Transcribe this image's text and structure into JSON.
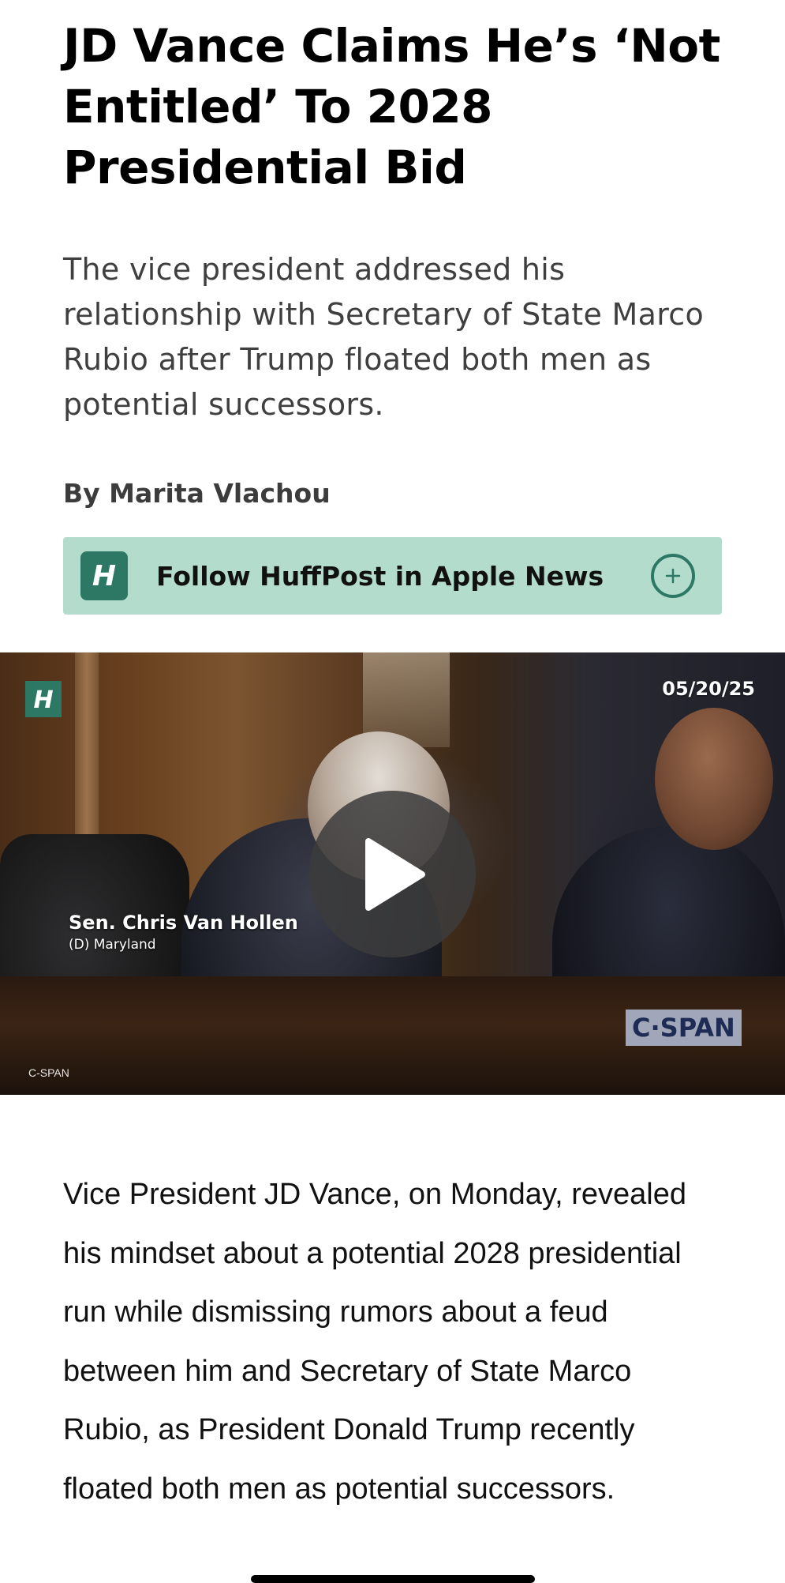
{
  "article": {
    "headline": "JD Vance Claims He’s ‘Not Entitled’ To 2028 Presidential Bid",
    "dek": "The vice president addressed his relationship with Secretary of State Marco Rubio after Trump floated both men as potential successors.",
    "byline": "By Marita Vlachou",
    "body_paragraph": "Vice President JD Vance, on Monday, revealed his mindset about a potential 2028 presidential run while dismissing rumors about a feud between him and Secretary of State Marco Rubio, as President Donald Trump recently floated both men as potential successors."
  },
  "follow_banner": {
    "logo_letter": "H",
    "label": "Follow HuffPost in Apple News",
    "action_symbol": "+",
    "background_color": "#b3dccd",
    "accent_color": "#2c7864"
  },
  "video": {
    "logo_letter": "H",
    "date": "05/20/25",
    "lower_third_name": "Sen. Chris Van Hollen",
    "lower_third_sub": "(D) Maryland",
    "network_bug": "C·SPAN",
    "credit": "C-SPAN",
    "play_icon": "play-icon"
  }
}
